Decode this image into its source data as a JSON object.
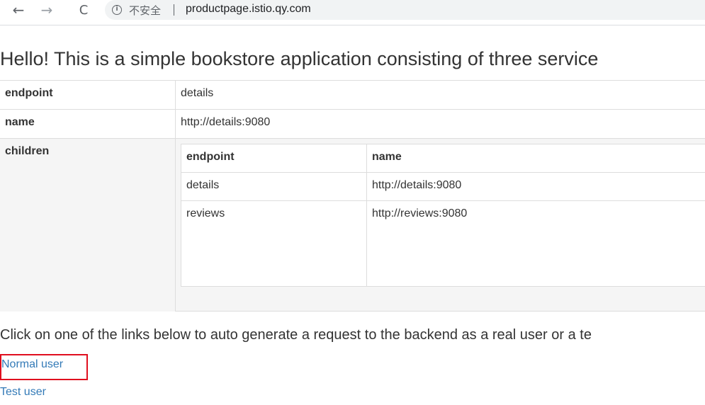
{
  "browser": {
    "back_icon": "←",
    "forward_icon": "→",
    "reload_icon": "C",
    "info_icon": "i",
    "security_label": "不安全",
    "url": "productpage.istio.qy.com"
  },
  "page": {
    "title": "Hello! This is a simple bookstore application consisting of three service",
    "details_table": {
      "rows": [
        {
          "key": "endpoint",
          "value": "details"
        },
        {
          "key": "name",
          "value": "http://details:9080"
        },
        {
          "key": "children"
        }
      ],
      "children": {
        "headers": [
          "endpoint",
          "name"
        ],
        "rows": [
          [
            "details",
            "http://details:9080"
          ],
          [
            "reviews",
            "http://reviews:9080"
          ]
        ]
      }
    },
    "instructions": "Click on one of the links below to auto generate a request to the backend as a real user or a te",
    "links": {
      "normal_user": "Normal user",
      "test_user": "Test user"
    }
  },
  "colors": {
    "link": "#337ab7",
    "highlight": "#e00f1f",
    "border": "#dddddd",
    "row_shade": "#f5f5f5"
  }
}
